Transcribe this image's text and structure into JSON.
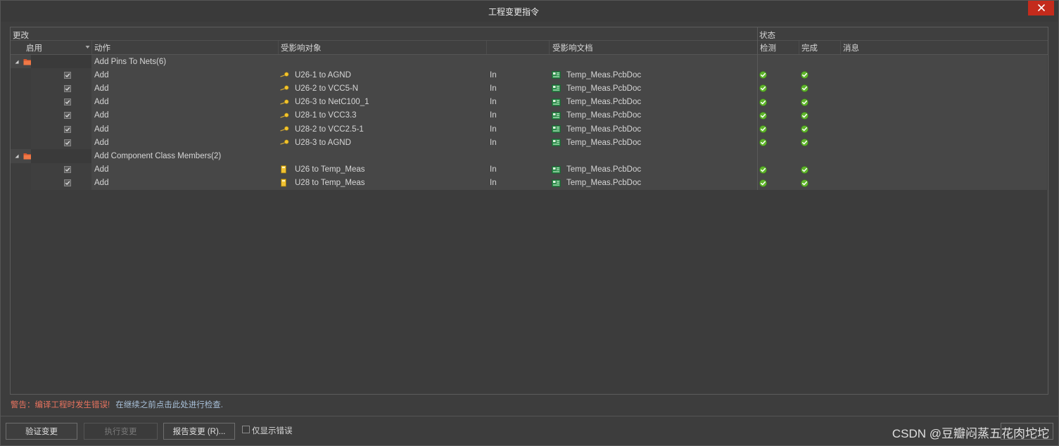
{
  "colors": {
    "warning_text": "#e8735f",
    "hint_text": "#a9c1da",
    "close_button": "#c42b1c",
    "success": "#5fb52b"
  },
  "window": {
    "title": "工程变更指令"
  },
  "grid": {
    "group_headers": {
      "changes": "更改",
      "status": "状态"
    },
    "columns": {
      "enable": "启用",
      "action": "动作",
      "affected_object": "受影响对象",
      "affected_document": "受影响文档",
      "check": "检测",
      "done": "完成",
      "message": "消息"
    },
    "groups": [
      {
        "label": "Add Pins To Nets(6)",
        "expanded": true,
        "icon": "folder-icon",
        "rows": [
          {
            "enabled": true,
            "action": "Add",
            "object_icon": "pin-icon",
            "object": "U26-1 to AGND",
            "direction": "In",
            "document_icon": "pcbdoc-icon",
            "document": "Temp_Meas.PcbDoc",
            "check_icon": "success-icon",
            "done_icon": "success-icon"
          },
          {
            "enabled": true,
            "action": "Add",
            "object_icon": "pin-icon",
            "object": "U26-2 to VCC5-N",
            "direction": "In",
            "document_icon": "pcbdoc-icon",
            "document": "Temp_Meas.PcbDoc",
            "check_icon": "success-icon",
            "done_icon": "success-icon"
          },
          {
            "enabled": true,
            "action": "Add",
            "object_icon": "pin-icon",
            "object": "U26-3 to NetC100_1",
            "direction": "In",
            "document_icon": "pcbdoc-icon",
            "document": "Temp_Meas.PcbDoc",
            "check_icon": "success-icon",
            "done_icon": "success-icon"
          },
          {
            "enabled": true,
            "action": "Add",
            "object_icon": "pin-icon",
            "object": "U28-1 to VCC3.3",
            "direction": "In",
            "document_icon": "pcbdoc-icon",
            "document": "Temp_Meas.PcbDoc",
            "check_icon": "success-icon",
            "done_icon": "success-icon"
          },
          {
            "enabled": true,
            "action": "Add",
            "object_icon": "pin-icon",
            "object": "U28-2 to VCC2.5-1",
            "direction": "In",
            "document_icon": "pcbdoc-icon",
            "document": "Temp_Meas.PcbDoc",
            "check_icon": "success-icon",
            "done_icon": "success-icon"
          },
          {
            "enabled": true,
            "action": "Add",
            "object_icon": "pin-icon",
            "object": "U28-3 to AGND",
            "direction": "In",
            "document_icon": "pcbdoc-icon",
            "document": "Temp_Meas.PcbDoc",
            "check_icon": "success-icon",
            "done_icon": "success-icon"
          }
        ]
      },
      {
        "label": "Add Component Class Members(2)",
        "expanded": true,
        "icon": "folder-icon",
        "rows": [
          {
            "enabled": true,
            "action": "Add",
            "object_icon": "component-icon",
            "object": "U26 to Temp_Meas",
            "direction": "In",
            "document_icon": "pcbdoc-icon",
            "document": "Temp_Meas.PcbDoc",
            "check_icon": "success-icon",
            "done_icon": "success-icon"
          },
          {
            "enabled": true,
            "action": "Add",
            "object_icon": "component-icon",
            "object": "U28 to Temp_Meas",
            "direction": "In",
            "document_icon": "pcbdoc-icon",
            "document": "Temp_Meas.PcbDoc",
            "check_icon": "success-icon",
            "done_icon": "success-icon"
          }
        ]
      }
    ]
  },
  "status_bar": {
    "warning": "警告：编译工程时发生错误!",
    "hint": "在继续之前点击此处进行检查."
  },
  "footer": {
    "validate_label": "验证变更",
    "execute_label": "执行变更",
    "report_label": "报告变更 (R)...",
    "only_errors_label": "仅显示错误",
    "only_errors_checked": false
  },
  "watermark": "CSDN @豆瓣闷蒸五花肉坨坨"
}
